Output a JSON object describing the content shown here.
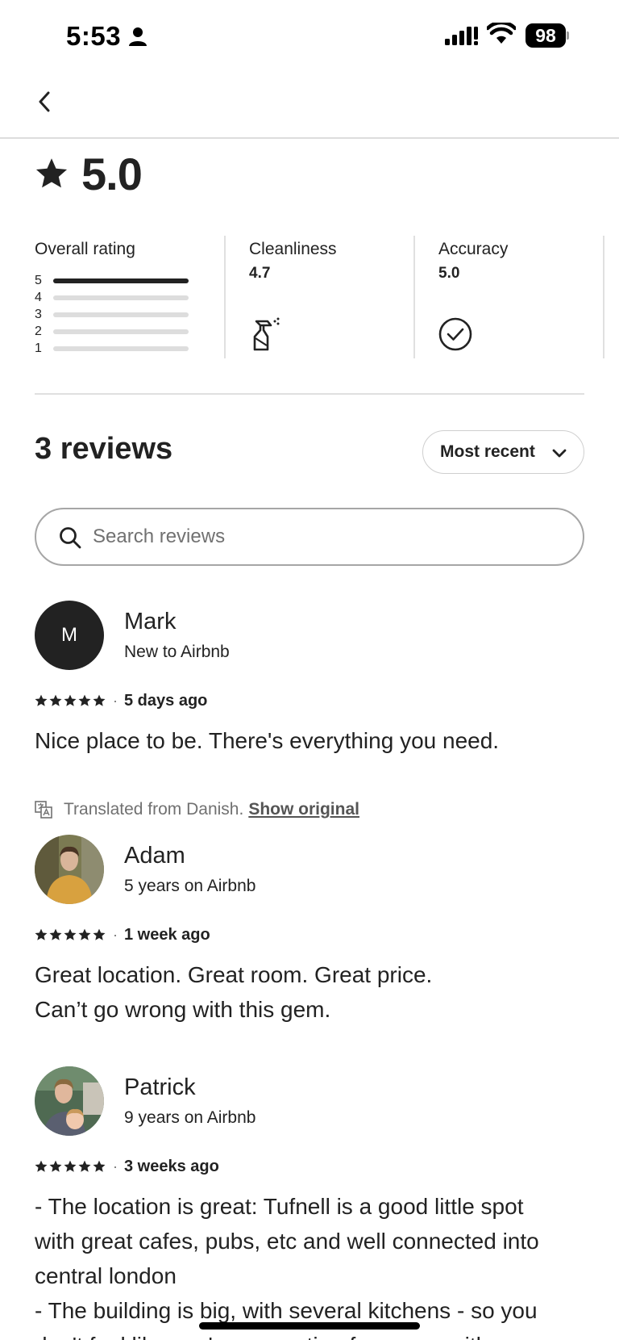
{
  "status_bar": {
    "time": "5:53",
    "battery": "98"
  },
  "rating": {
    "score": "5.0",
    "overall_label": "Overall rating",
    "distribution": [
      {
        "stars": "5",
        "fraction": 1.0
      },
      {
        "stars": "4",
        "fraction": 0
      },
      {
        "stars": "3",
        "fraction": 0
      },
      {
        "stars": "2",
        "fraction": 0
      },
      {
        "stars": "1",
        "fraction": 0
      }
    ],
    "categories": [
      {
        "label": "Cleanliness",
        "value": "4.7",
        "icon": "spray-bottle-icon"
      },
      {
        "label": "Accuracy",
        "value": "5.0",
        "icon": "check-circle-icon"
      }
    ]
  },
  "reviews_header": {
    "count_label": "3 reviews",
    "sort_label": "Most recent"
  },
  "search": {
    "placeholder": "Search reviews"
  },
  "reviews": [
    {
      "name": "Mark",
      "tenure": "New to Airbnb",
      "avatar_letter": "M",
      "stars": 5,
      "date": "5 days ago",
      "text": "Nice place to be. There's everything you need.",
      "translation_note": "Translated from Danish.",
      "show_original": "Show original"
    },
    {
      "name": "Adam",
      "tenure": "5 years on Airbnb",
      "stars": 5,
      "date": "1 week ago",
      "text_lines": [
        "Great location. Great room. Great price.",
        "Can’t go wrong with this gem."
      ]
    },
    {
      "name": "Patrick",
      "tenure": "9 years on Airbnb",
      "stars": 5,
      "date": "3 weeks ago",
      "text_lines": [
        "- The location is great: Tufnell is a good little spot",
        "with great cafes, pubs, etc and well connected into",
        "central london",
        "- The building is big, with several kitchens - so you",
        "don't feel like you're competing for space with"
      ]
    }
  ],
  "colors": {
    "text": "#222222",
    "muted": "#717171",
    "divider": "#dddddd"
  }
}
